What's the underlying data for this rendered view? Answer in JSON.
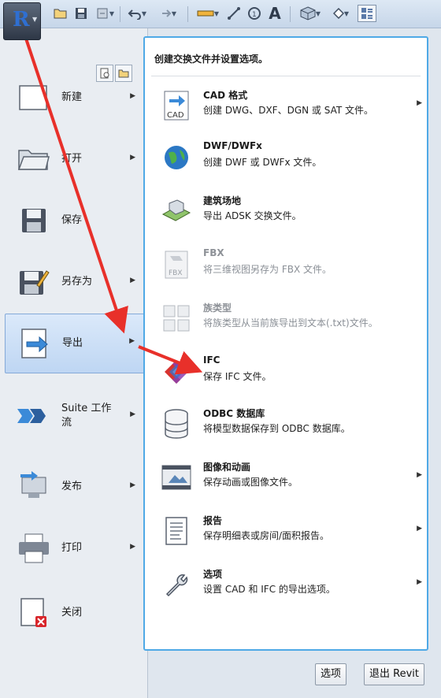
{
  "app": {
    "logo_letter": "R"
  },
  "quick_access_toolbar": {
    "icons": [
      "open-icon",
      "save-icon",
      "sync-icon",
      "undo-icon",
      "redo-icon",
      "measure-icon",
      "dimension-icon",
      "tag-icon",
      "text-icon",
      "3d-view-icon",
      "section-icon",
      "switch-windows-icon"
    ],
    "text_tool": "A"
  },
  "left_menu": {
    "items": [
      {
        "label": "新建",
        "icon": "new-file-icon",
        "has_submenu": true
      },
      {
        "label": "打开",
        "icon": "open-folder-icon",
        "has_submenu": true
      },
      {
        "label": "保存",
        "icon": "save-disk-icon",
        "has_submenu": false
      },
      {
        "label": "另存为",
        "icon": "save-as-icon",
        "has_submenu": true
      },
      {
        "label": "导出",
        "icon": "export-icon",
        "has_submenu": true,
        "active": true
      },
      {
        "label": "Suite 工作流",
        "icon": "suite-workflow-icon",
        "has_submenu": true
      },
      {
        "label": "发布",
        "icon": "publish-icon",
        "has_submenu": true
      },
      {
        "label": "打印",
        "icon": "printer-icon",
        "has_submenu": true
      },
      {
        "label": "关闭",
        "icon": "close-document-icon",
        "has_submenu": false
      }
    ]
  },
  "submenu": {
    "header": "创建交换文件并设置选项。",
    "items": [
      {
        "title": "CAD 格式",
        "desc": "创建 DWG、DXF、DGN 或 SAT 文件。",
        "icon": "cad-format-icon",
        "icon_label": "CAD",
        "has_submenu": true,
        "disabled": false
      },
      {
        "title": "DWF/DWFx",
        "desc": "创建 DWF 或 DWFx 文件。",
        "icon": "dwf-globe-icon",
        "has_submenu": false,
        "disabled": false
      },
      {
        "title": "建筑场地",
        "desc": "导出 ADSK 交换文件。",
        "icon": "building-site-icon",
        "has_submenu": false,
        "disabled": false
      },
      {
        "title": "FBX",
        "desc": "将三维视图另存为 FBX 文件。",
        "icon": "fbx-icon",
        "icon_label": "FBX",
        "has_submenu": false,
        "disabled": true
      },
      {
        "title": "族类型",
        "desc": "将族类型从当前族导出到文本(.txt)文件。",
        "icon": "family-types-icon",
        "has_submenu": false,
        "disabled": true
      },
      {
        "title": "IFC",
        "desc": "保存 IFC 文件。",
        "icon": "ifc-icon",
        "has_submenu": false,
        "disabled": false
      },
      {
        "title": "ODBC 数据库",
        "desc": "将模型数据保存到 ODBC 数据库。",
        "icon": "database-icon",
        "has_submenu": false,
        "disabled": false
      },
      {
        "title": "图像和动画",
        "desc": "保存动画或图像文件。",
        "icon": "image-animation-icon",
        "has_submenu": true,
        "disabled": false
      },
      {
        "title": "报告",
        "desc": "保存明细表或房间/面积报告。",
        "icon": "report-icon",
        "has_submenu": true,
        "disabled": false
      },
      {
        "title": "选项",
        "desc": "设置 CAD 和 IFC 的导出选项。",
        "icon": "wrench-options-icon",
        "has_submenu": true,
        "disabled": false
      }
    ]
  },
  "footer": {
    "options_label": "选项",
    "exit_label": "退出 Revit"
  },
  "colors": {
    "accent_border": "#4fa9e6",
    "active_item": "#bed6f3",
    "annotation_arrow": "#e8302a"
  }
}
